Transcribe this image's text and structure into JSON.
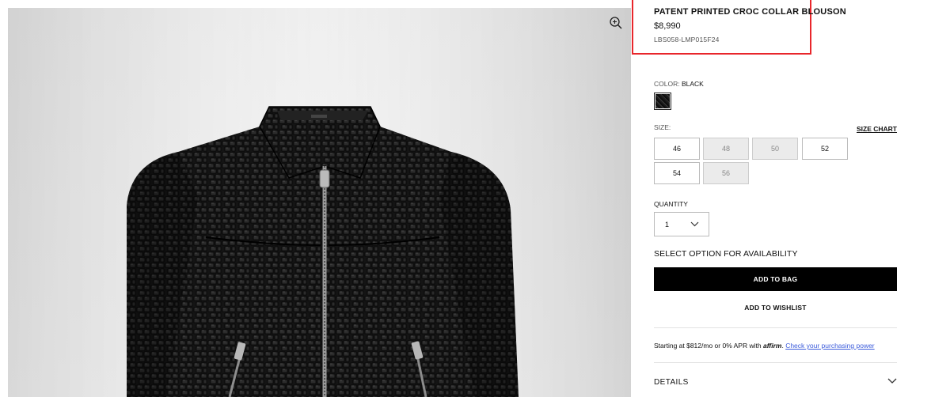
{
  "product": {
    "title": "PATENT PRINTED CROC COLLAR BLOUSON",
    "price": "$8,990",
    "sku": "LBS058-LMP015F24"
  },
  "color": {
    "label": "COLOR:",
    "value": "BLACK"
  },
  "size": {
    "label": "SIZE:",
    "chart_link": "SIZE CHART",
    "options": [
      {
        "label": "46",
        "available": true
      },
      {
        "label": "48",
        "available": false
      },
      {
        "label": "50",
        "available": false
      },
      {
        "label": "52",
        "available": true
      },
      {
        "label": "54",
        "available": true
      },
      {
        "label": "56",
        "available": false
      }
    ]
  },
  "quantity": {
    "label": "QUANTITY",
    "value": "1"
  },
  "availability_text": "SELECT OPTION FOR AVAILABILITY",
  "actions": {
    "add_to_bag": "ADD TO BAG",
    "add_to_wishlist": "ADD TO WISHLIST"
  },
  "financing": {
    "prefix": "Starting at $812/mo or 0% APR with",
    "brand": "affirm",
    "link": "Check your purchasing power"
  },
  "details_label": "DETAILS",
  "jacket_label": "TOM FORD",
  "colors": {
    "highlight": "#e8262b",
    "button": "#000000",
    "unavailable": "#ebebeb"
  }
}
